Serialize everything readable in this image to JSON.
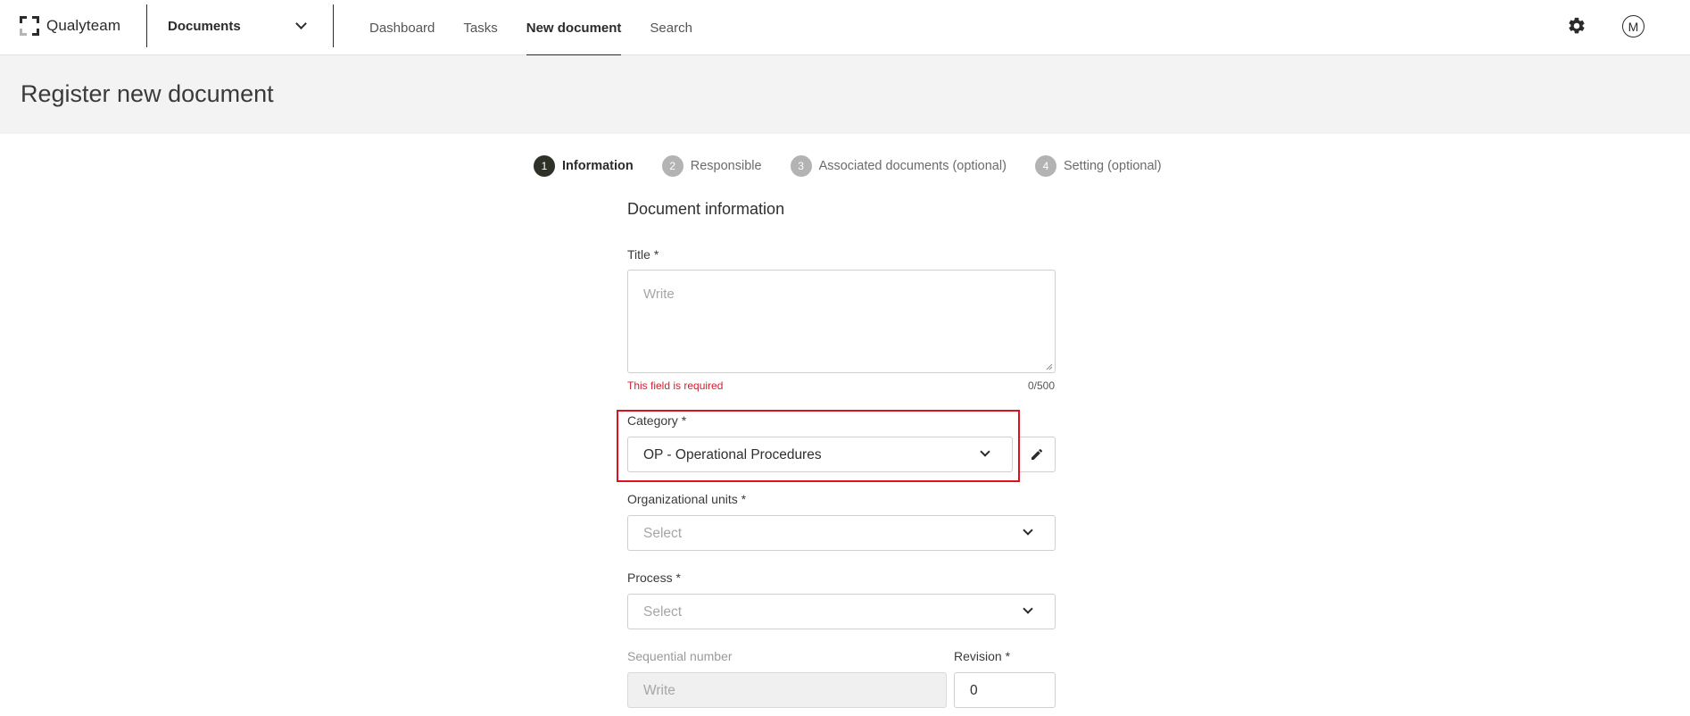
{
  "app": {
    "name": "Qualyteam",
    "module": "Documents"
  },
  "nav": {
    "items": [
      "Dashboard",
      "Tasks",
      "New document",
      "Search"
    ],
    "active": "New document"
  },
  "user": {
    "initial": "M"
  },
  "page": {
    "title": "Register new document"
  },
  "stepper": {
    "steps": [
      {
        "num": "1",
        "label": "Information"
      },
      {
        "num": "2",
        "label": "Responsible"
      },
      {
        "num": "3",
        "label": "Associated documents (optional)"
      },
      {
        "num": "4",
        "label": "Setting (optional)"
      }
    ],
    "active": 0
  },
  "form": {
    "section_title": "Document information",
    "title_field": {
      "label": "Title *",
      "placeholder": "Write",
      "error": "This field is required",
      "counter": "0/500"
    },
    "category": {
      "label": "Category *",
      "value": "OP - Operational Procedures"
    },
    "org_units": {
      "label": "Organizational units *",
      "placeholder": "Select"
    },
    "process": {
      "label": "Process *",
      "placeholder": "Select"
    },
    "sequential": {
      "label": "Sequential number",
      "placeholder": "Write"
    },
    "revision": {
      "label": "Revision *",
      "value": "0"
    }
  },
  "colors": {
    "accent": "#2e3127",
    "error": "#d0212f",
    "highlight": "#e0101e"
  }
}
